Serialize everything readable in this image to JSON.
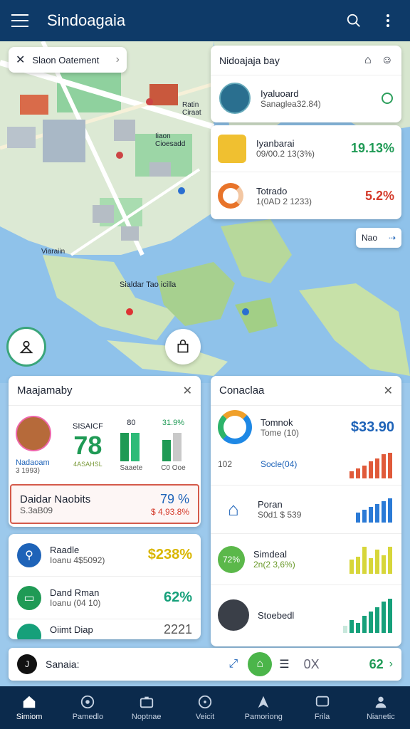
{
  "app": {
    "title": "Sindoagaia"
  },
  "map": {
    "search_text": "Slaon Oatement",
    "labels": {
      "island1": "Sialdar Tao icilla",
      "place1": "Viaraiin",
      "place2": "Iiaon Cioesadd",
      "place3": "Ratin Ciraat"
    },
    "zoom_badge": "Nao"
  },
  "topright_panel": {
    "header": "Nidoajaja bay",
    "items": [
      {
        "name": "Iyaluoard",
        "sub": "Sanaglea32.84)"
      },
      {
        "name": "Iyanbarai",
        "sub": "09/00.2 13(3%)",
        "value": "19.13%"
      },
      {
        "name": "Totrado",
        "sub": "1(0AD 2 1233)",
        "value": "5.2%"
      }
    ]
  },
  "left_panel": {
    "title": "Maajamaby",
    "profile_label": "Nadaoam",
    "profile_sub": "3 1993)",
    "stat1_label": "SISAICF",
    "stat1_value": "78",
    "stat1_sub": "4ASAHSL",
    "stat2_label": "80",
    "stat2_sub": "Saaete",
    "stat3_label": "31.9%",
    "stat3_sub": "C0 Ooe",
    "highlight_title": "Daidar Naobits",
    "highlight_sub": "S.3aB09",
    "highlight_value": "79 %",
    "highlight_value_sub": "$ 4,93.8%"
  },
  "left_list": {
    "items": [
      {
        "name": "Raadle",
        "sub": "Ioanu 4$5092)",
        "value": "$238%"
      },
      {
        "name": "Dand Rman",
        "sub": "Ioanu (04 10)",
        "value": "62%"
      },
      {
        "name": "Oiimt Diap",
        "value": "2221"
      }
    ]
  },
  "right_panel": {
    "title": "Conaclaa",
    "items": [
      {
        "name": "Tomnok",
        "sub": "Tome (10)",
        "value": "$33.90",
        "foot_left": "102",
        "foot_right": "Socle(04)"
      },
      {
        "name": "Poran",
        "sub": "S0d1 $ 539"
      },
      {
        "name": "Simdeal",
        "sub": "2n(2 3,6%)",
        "badge": "72%"
      },
      {
        "name": "Stoebedl"
      }
    ]
  },
  "footer_strip": {
    "label": "Sanaia:",
    "avatar_letter": "J",
    "right_text": "0X",
    "right_value": "62"
  },
  "nav": [
    {
      "label": "Simiom",
      "icon": "home-icon"
    },
    {
      "label": "Pamedlo",
      "icon": "target-icon"
    },
    {
      "label": "Noptnae",
      "icon": "briefcase-icon"
    },
    {
      "label": "Veicit",
      "icon": "compass-icon"
    },
    {
      "label": "Pamoriong",
      "icon": "route-icon"
    },
    {
      "label": "Frila",
      "icon": "chat-icon"
    },
    {
      "label": "Nianetic",
      "icon": "people-icon"
    }
  ],
  "colors": {
    "primary": "#0e3a68",
    "green": "#1f9a55",
    "red": "#d43a2a",
    "blue": "#1e63b8",
    "yellow": "#d9b600",
    "teal": "#16a07a"
  }
}
